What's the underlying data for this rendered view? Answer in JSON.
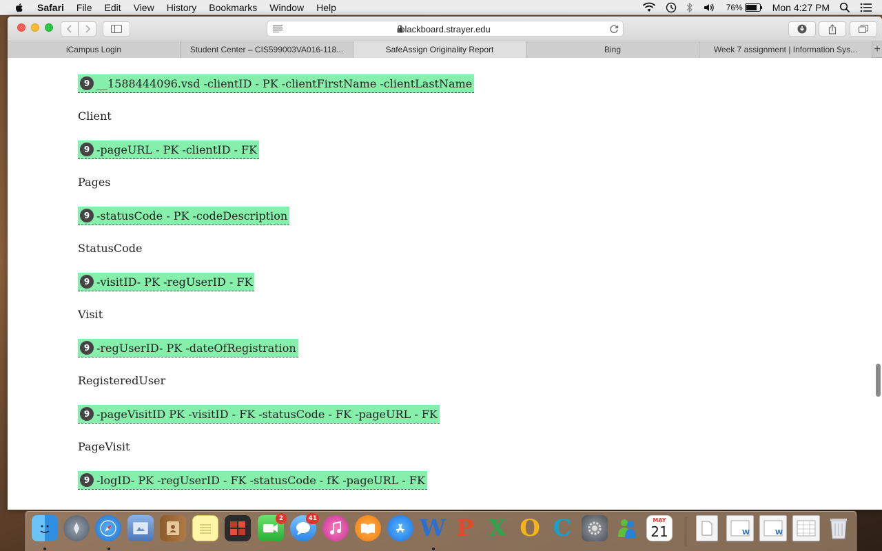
{
  "menubar": {
    "app": "Safari",
    "items": [
      "File",
      "Edit",
      "View",
      "History",
      "Bookmarks",
      "Window",
      "Help"
    ],
    "battery": "76%",
    "clock": "Mon 4:27 PM"
  },
  "toolbar": {
    "url": "blackboard.strayer.edu"
  },
  "tabs": [
    {
      "label": "iCampus Login"
    },
    {
      "label": "Student Center – CIS599003VA016-118..."
    },
    {
      "label": "SafeAssign Originality Report"
    },
    {
      "label": "Bing"
    },
    {
      "label": "Week 7 assignment | Information Sys..."
    }
  ],
  "content": {
    "blocks": [
      {
        "kind": "match",
        "num": "9",
        "text": "__1588444096.vsd -clientID - PK -clientFirstName -clientLastName"
      },
      {
        "kind": "label",
        "text": "Client"
      },
      {
        "kind": "match",
        "num": "9",
        "text": "-pageURL - PK -clientID - FK"
      },
      {
        "kind": "label",
        "text": "Pages"
      },
      {
        "kind": "match",
        "num": "9",
        "text": "-statusCode - PK -codeDescription"
      },
      {
        "kind": "label",
        "text": "StatusCode"
      },
      {
        "kind": "match",
        "num": "9",
        "text": "-visitID- PK -regUserID - FK"
      },
      {
        "kind": "label",
        "text": "Visit"
      },
      {
        "kind": "match",
        "num": "9",
        "text": "-regUserID- PK -dateOfRegistration"
      },
      {
        "kind": "label",
        "text": "RegisteredUser"
      },
      {
        "kind": "match",
        "num": "9",
        "text": "-pageVisitID PK -visitID - FK -statusCode - FK -pageURL - FK"
      },
      {
        "kind": "label",
        "text": "PageVisit"
      },
      {
        "kind": "match",
        "num": "9",
        "text": "-logID- PK -regUserID - FK -statusCode - fK -pageURL - FK"
      }
    ]
  },
  "dock": {
    "messages_badge": "2",
    "messages2_badge": "41",
    "calendar_month": "MAY",
    "calendar_day": "21"
  },
  "colors": {
    "match_highlight": "#86efac",
    "badge": "#444444"
  }
}
